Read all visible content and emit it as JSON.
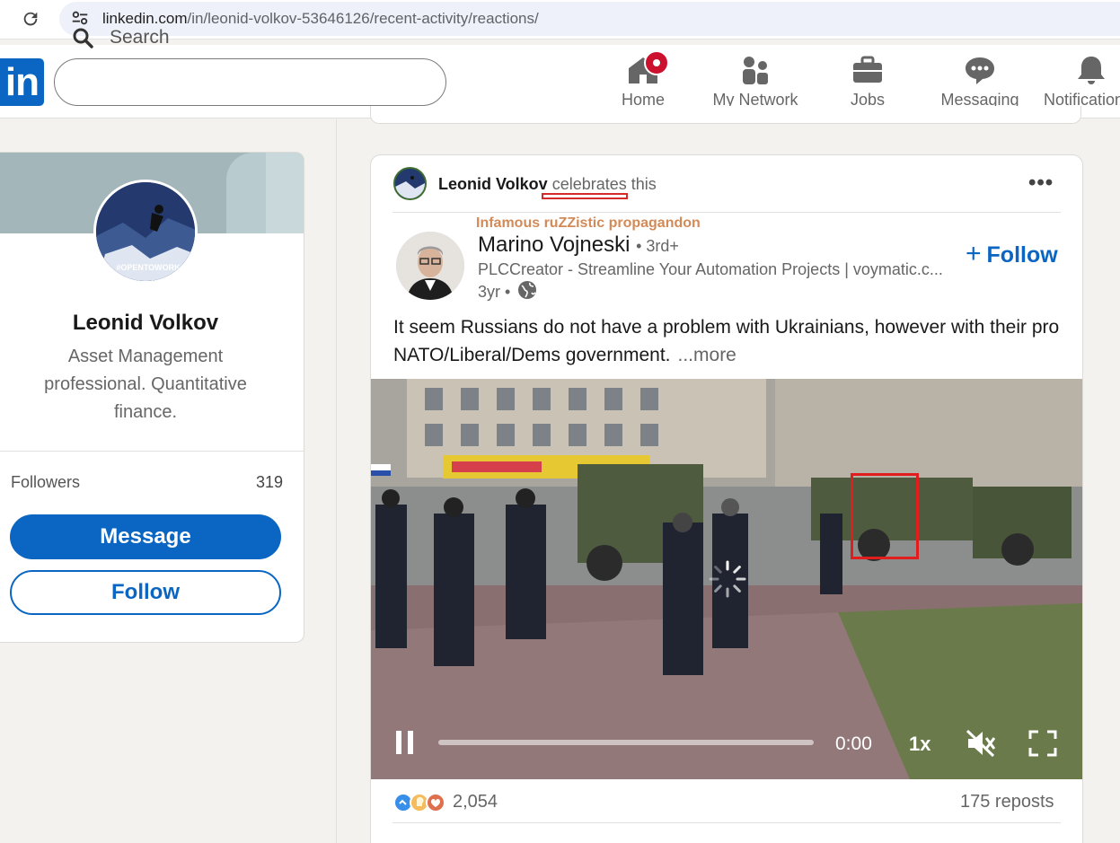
{
  "browser": {
    "url_host": "linkedin.com",
    "url_path": "/in/leonid-volkov-53646126/recent-activity/reactions/"
  },
  "nav": {
    "logo": "in",
    "search_placeholder": "Search",
    "items": [
      {
        "label": "Home",
        "icon": "home-icon"
      },
      {
        "label": "My Network",
        "icon": "network-icon"
      },
      {
        "label": "Jobs",
        "icon": "briefcase-icon"
      },
      {
        "label": "Messaging",
        "icon": "chat-icon"
      },
      {
        "label": "Notifications",
        "icon": "bell-icon"
      }
    ]
  },
  "profile": {
    "name": "Leonid Volkov",
    "headline": "Asset Management professional. Quantitative finance.",
    "avatar_badge": "#OPENTOWORK",
    "followers_label": "Followers",
    "followers_count": "319",
    "message_button": "Message",
    "follow_button": "Follow"
  },
  "post": {
    "actor_name": "Leonid Volkov",
    "actor_action": "celebrates",
    "actor_suffix": "this",
    "annotation": "Infamous ruZZistic propagandon",
    "author_name": "Marino Vojneski",
    "author_degree": "• 3rd+",
    "author_headline": "PLCCreator - Streamline Your Automation Projects | voymatic.c...",
    "time": "3yr •",
    "follow_label": "Follow",
    "text": "It seem Russians do not have a problem with Ukrainians, however with their pro NATO/Liberal/Dems government.",
    "more_label": "...more",
    "video": {
      "time": "0:00",
      "speed": "1x",
      "progress": 0
    },
    "reactions_count": "2,054",
    "reposts": "175 reposts"
  },
  "colors": {
    "linkedin_blue": "#0a66c2",
    "annotation_red": "#e11d1d",
    "notification_red": "#cb112d"
  }
}
